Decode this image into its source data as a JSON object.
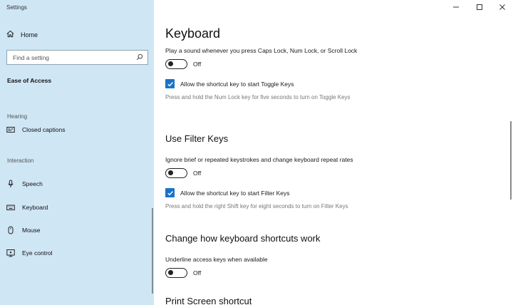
{
  "window": {
    "title": "Settings",
    "minimize_icon": "minimize-icon",
    "maximize_icon": "maximize-icon",
    "close_icon": "close-icon"
  },
  "sidebar": {
    "home_label": "Home",
    "search_placeholder": "Find a setting",
    "section_title": "Ease of Access",
    "groups": [
      {
        "label": "Hearing",
        "items": [
          {
            "label": "Closed captions",
            "icon": "closed-captions-icon"
          }
        ]
      },
      {
        "label": "Interaction",
        "items": [
          {
            "label": "Speech",
            "icon": "microphone-icon"
          },
          {
            "label": "Keyboard",
            "icon": "keyboard-icon"
          },
          {
            "label": "Mouse",
            "icon": "mouse-icon"
          },
          {
            "label": "Eye control",
            "icon": "eye-control-icon"
          }
        ]
      }
    ]
  },
  "main": {
    "title": "Keyboard",
    "toggle_keys": {
      "description": "Play a sound whenever you press Caps Lock, Num Lock, or Scroll Lock",
      "toggle_state": "Off",
      "shortcut_label": "Allow the shortcut key to start Toggle Keys",
      "shortcut_checked": true,
      "help_text": "Press and hold the Num Lock key for five seconds to turn on Toggle Keys"
    },
    "filter_keys": {
      "heading": "Use Filter Keys",
      "description": "Ignore brief or repeated keystrokes and change keyboard repeat rates",
      "toggle_state": "Off",
      "shortcut_label": "Allow the shortcut key to start Filter Keys",
      "shortcut_checked": true,
      "help_text": "Press and hold the right Shift key for eight seconds to turn on Filter Keys"
    },
    "shortcuts": {
      "heading": "Change how keyboard shortcuts work",
      "description": "Underline access keys when available",
      "toggle_state": "Off"
    },
    "print_screen": {
      "heading": "Print Screen shortcut"
    }
  },
  "colors": {
    "sidebar_bg": "#cfe6f5",
    "accent": "#1a73c8"
  }
}
